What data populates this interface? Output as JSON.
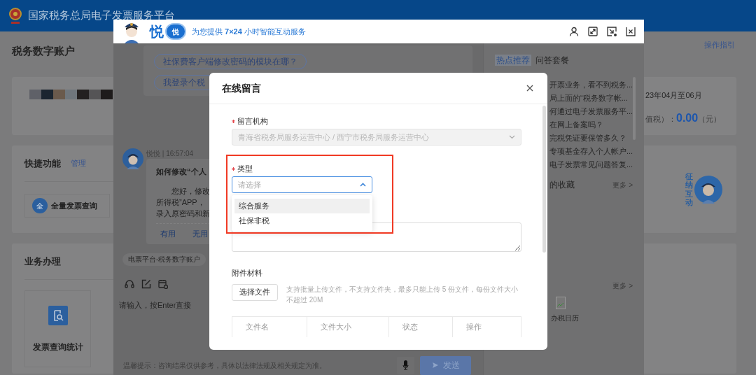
{
  "header": {
    "title": "国家税务总局电子发票服务平台"
  },
  "page": {
    "title": "税务数字账户",
    "guide_link": "操作指引",
    "quick": {
      "title": "快捷功能",
      "manage": "管理",
      "items": [
        {
          "icon_text": "全",
          "label": "全量发票查询"
        }
      ]
    },
    "business": {
      "title": "业务办理",
      "items": [
        {
          "label": "发票查询统计"
        }
      ]
    },
    "period": "23年04月至06月",
    "tax_label": "值税）：",
    "tax_amount": "0.00",
    "tax_unit": "（元）",
    "mascot_label": "征纳互动"
  },
  "chat": {
    "brand": "悦",
    "badge": "悦",
    "tagline": "为您提供 **7×24** 小时智能互动服务",
    "suggestions": [
      "社保费客户端修改密码的模块在哪？",
      "我登录个税"
    ],
    "message": {
      "sender": "悦悦 | 16:57:04",
      "title": "如何修改“个人",
      "lines": [
        "您好，修改",
        "所得税”APP，",
        "录入原密码和新"
      ],
      "feedback": [
        "有用",
        "无用"
      ]
    },
    "context_chip": "电票平台-税务数字账户",
    "input_placeholder": "请输入，按Enter直接",
    "notice": "温馨提示：咨询结果仅供参考，具体以法律法规及相关规定为准。",
    "send": "发送",
    "tabs": [
      {
        "label": "热点推荐",
        "selected": true
      },
      {
        "label": "问答套餐",
        "selected": false
      }
    ],
    "hot_questions": [
      "开票业务，看不到税务...",
      "局上面的“税务数字帐...",
      "何通过电子发票服务平...",
      "在网上备案吗？",
      "完税凭证要保管多久？",
      "专项基金存入个人帐户...",
      "电子发票常见问题答复..."
    ],
    "favorites": {
      "title": "的收藏",
      "more": "更多 >"
    },
    "calendar": {
      "more": "更多 >",
      "label": "办税日历"
    }
  },
  "modal": {
    "title": "在线留言",
    "fields": [
      {
        "kind": "select",
        "label": "留言机构",
        "required": true,
        "disabled": true,
        "expanded": false,
        "highlighted": false,
        "value": "青海省税务局服务运营中心 / 西宁市税务局服务运营中心"
      },
      {
        "kind": "select",
        "label": "类型",
        "required": true,
        "disabled": false,
        "expanded": true,
        "highlighted": true,
        "placeholder": "请选择",
        "options": [
          {
            "label": "综合服务",
            "hovered": true
          },
          {
            "label": "社保非税",
            "hovered": false
          }
        ]
      },
      {
        "kind": "textarea"
      }
    ],
    "attachments": {
      "label": "附件材料",
      "button": "选择文件",
      "hint": "支持批量上传文件，不支持文件夹，最多只能上传 5 份文件，每份文件大小不超过 20M",
      "columns": [
        "文件名",
        "文件大小",
        "状态",
        "操作"
      ]
    }
  }
}
